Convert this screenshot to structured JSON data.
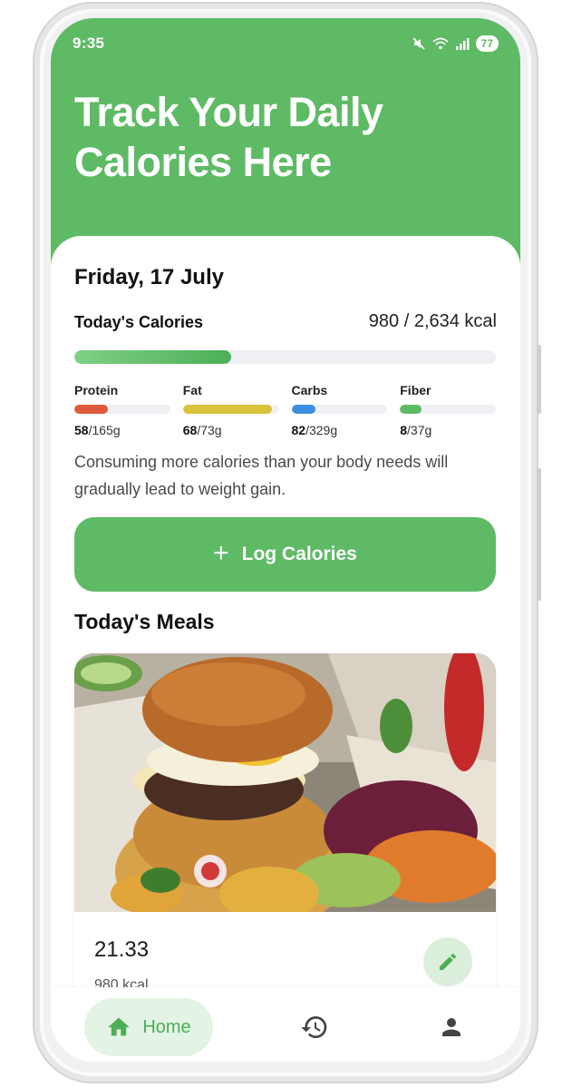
{
  "status_bar": {
    "time": "9:35",
    "battery": "77"
  },
  "header": {
    "title": "Track Your Daily Calories Here"
  },
  "summary": {
    "date": "Friday, 17 July",
    "calories_label": "Today's Calories",
    "calories_value": "980 / 2,634 kcal",
    "calories_progress": 0.372,
    "macros": [
      {
        "name": "Protein",
        "current": "58",
        "total": "/165g",
        "progress": 0.35,
        "color": "#dd5a3b"
      },
      {
        "name": "Fat",
        "current": "68",
        "total": "/73g",
        "progress": 0.93,
        "color": "#d9c33a"
      },
      {
        "name": "Carbs",
        "current": "82",
        "total": "/329g",
        "progress": 0.25,
        "color": "#3b8ee0"
      },
      {
        "name": "Fiber",
        "current": "8",
        "total": "/37g",
        "progress": 0.22,
        "color": "#5fba66"
      }
    ],
    "warning": "Consuming more calories than your body needs will gradually lead to weight gain."
  },
  "actions": {
    "log_label": "Log Calories"
  },
  "meals": {
    "title": "Today's Meals",
    "items": [
      {
        "name": "21.33",
        "calories": "980 kcal"
      }
    ]
  },
  "nav": {
    "home_label": "Home"
  },
  "colors": {
    "accent": "#5fba66",
    "accent_light": "#e3f3e4"
  }
}
